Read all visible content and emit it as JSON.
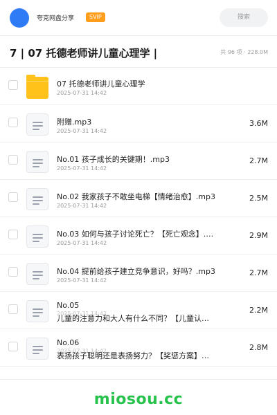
{
  "header": {
    "app_name": "夸克网盘分享",
    "badge": "SVIP",
    "search_placeholder": "搜索"
  },
  "folder": {
    "title": "7 | 07 托德老师讲儿童心理学 |",
    "meta": "共 96 项 · 228.0M"
  },
  "files": [
    {
      "type": "folder",
      "name": "07 托德老师讲儿童心理学",
      "date": "2025-07-31 14:42",
      "size": ""
    },
    {
      "type": "audio",
      "name": "附赠.mp3",
      "date": "2025-07-31 14:42",
      "size": "3.6M"
    },
    {
      "type": "audio",
      "name": "No.01 孩子成长的关键期！.mp3",
      "date": "2025-07-31 14:42",
      "size": "2.7M"
    },
    {
      "type": "audio",
      "name": "No.02 我家孩子不敢坐电梯【情绪治愈】.mp3",
      "date": "2025-07-31 14:42",
      "size": "2.5M"
    },
    {
      "type": "audio",
      "name": "No.03 如何与孩子讨论死亡？【死亡观念】.mp3",
      "date": "2025-07-31 14:42",
      "size": "2.9M"
    },
    {
      "type": "audio",
      "name": "No.04 提前给孩子建立竞争意识，好吗？.mp3",
      "date": "2025-07-31 14:42",
      "size": "2.7M"
    },
    {
      "type": "audio",
      "name": "No.05",
      "name2": "儿童的注意力和大人有什么不同？【儿童认…",
      "date": "2025-07-31 14:42",
      "size": "2.2M"
    },
    {
      "type": "audio",
      "name": "No.06",
      "name2": "表扬孩子聪明还是表扬努力？【奖惩方案】…",
      "date": "2025-07-31 14:42",
      "size": "2.8M"
    }
  ],
  "watermark": "miosou.cc",
  "colors": {
    "accent": "#2f7bf6",
    "svip": "#ff9e1b",
    "folder": "#ffc21a",
    "watermark": "#27c24c"
  }
}
